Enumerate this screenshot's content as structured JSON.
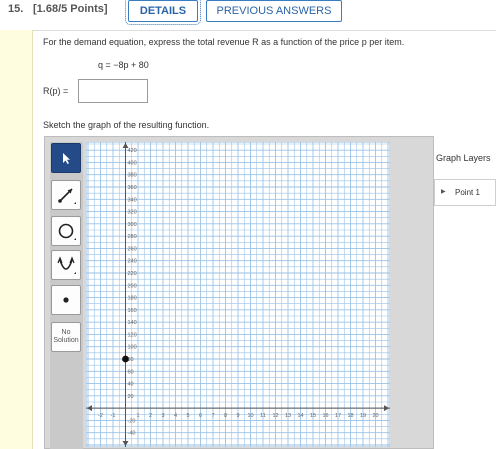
{
  "question": {
    "number": "15.",
    "points": "[1.68/5 Points]",
    "details_label": "DETAILS",
    "previous_answers_label": "PREVIOUS ANSWERS",
    "prompt": "For the demand equation, express the total revenue R as a function of the price p per item.",
    "equation": "q = −8p + 80",
    "answer_label": "R(p) =",
    "answer_value": "",
    "sketch_prompt": "Sketch the graph of the resulting function."
  },
  "tools": {
    "no_solution_line1": "No",
    "no_solution_line2": "Solution",
    "icons": [
      "pointer-icon",
      "line-tool-icon",
      "circle-tool-icon",
      "parabola-tool-icon",
      "point-tool-icon"
    ]
  },
  "graph_layers": {
    "title": "Graph Layers",
    "items": [
      {
        "label": "Point 1"
      }
    ]
  },
  "graph": {
    "x_ticks": [
      -2,
      -1,
      1,
      2,
      3,
      4,
      5,
      6,
      7,
      8,
      9,
      10,
      11,
      12,
      13,
      14,
      15,
      16,
      17,
      18,
      19,
      20
    ],
    "y_ticks": [
      420,
      400,
      380,
      360,
      340,
      320,
      300,
      280,
      260,
      240,
      220,
      200,
      180,
      160,
      140,
      120,
      100,
      80,
      60,
      40,
      20,
      -20,
      -40
    ],
    "x_range": [
      -3,
      21
    ],
    "y_range": [
      -60,
      430
    ],
    "point": {
      "x": 0,
      "y": 80
    },
    "grid_color": "#9ac2e6",
    "axis_color": "#555555",
    "point_color": "#111111"
  }
}
